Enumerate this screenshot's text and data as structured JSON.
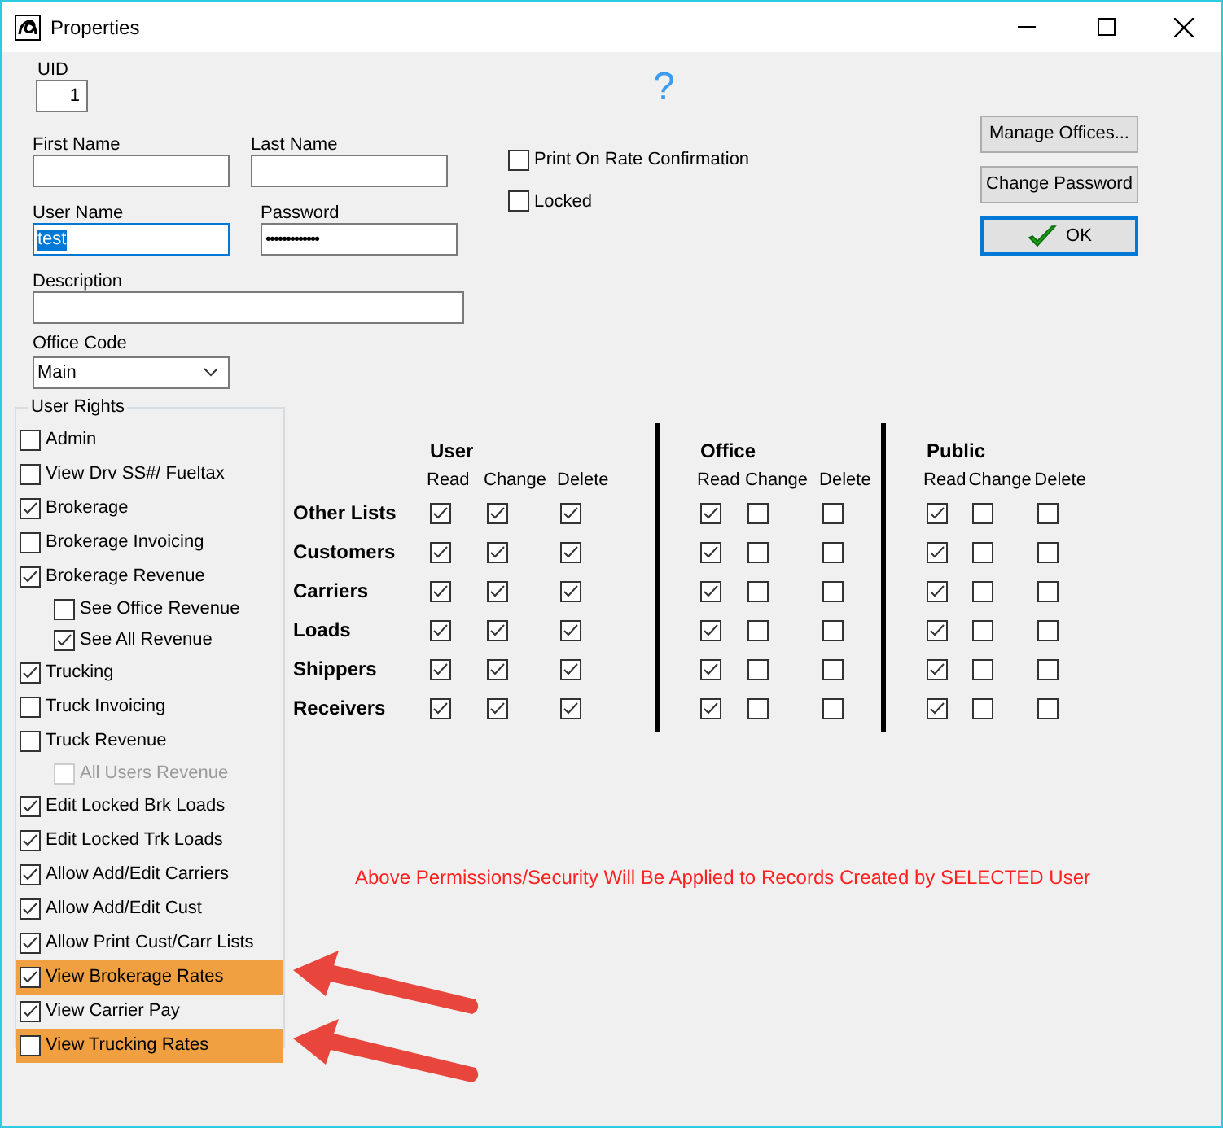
{
  "window": {
    "title": "Properties"
  },
  "uid": {
    "label": "UID",
    "value": "1"
  },
  "help": "?",
  "fields": [
    {
      "label": "First Name",
      "kind": "text"
    },
    {
      "label": "Last Name",
      "kind": "text"
    },
    {
      "label": "User Name",
      "kind": "text",
      "value": "test",
      "focused": true
    },
    {
      "label": "Password",
      "kind": "password",
      "value": "•••••••••••••",
      "focused": false
    },
    {
      "label": "Description",
      "kind": "text"
    },
    {
      "label": "Office Code",
      "kind": "select",
      "value": "Main"
    }
  ],
  "options": [
    {
      "label": "Print On Rate Confirmation",
      "checked": false
    },
    {
      "label": "Locked",
      "checked": false
    }
  ],
  "buttons": [
    {
      "label": "Manage Offices...",
      "default": false
    },
    {
      "label": "Change Password",
      "default": false
    },
    {
      "label": "OK",
      "default": true
    }
  ],
  "user_rights": {
    "title": "User Rights",
    "items": [
      {
        "label": "Admin",
        "checked": false,
        "highlighted": false
      },
      {
        "label": "View Drv SS#/ Fueltax",
        "checked": false,
        "highlighted": false
      },
      {
        "label": "Brokerage",
        "checked": true,
        "highlighted": false
      },
      {
        "label": "Brokerage Invoicing",
        "checked": false,
        "highlighted": false
      },
      {
        "label": "Brokerage Revenue",
        "checked": true,
        "highlighted": false,
        "children": [
          {
            "label": "See Office Revenue",
            "checked": false,
            "disabled": false
          },
          {
            "label": "See All Revenue",
            "checked": true,
            "disabled": false
          }
        ]
      },
      {
        "label": "Trucking",
        "checked": true,
        "highlighted": false
      },
      {
        "label": "Truck Invoicing",
        "checked": false,
        "highlighted": false
      },
      {
        "label": "Truck Revenue",
        "checked": false,
        "highlighted": false,
        "children": [
          {
            "label": "All Users Revenue",
            "checked": false,
            "disabled": true
          }
        ]
      },
      {
        "label": "Edit Locked Brk Loads",
        "checked": true,
        "highlighted": false
      },
      {
        "label": "Edit Locked Trk Loads",
        "checked": true,
        "highlighted": false
      },
      {
        "label": "Allow Add/Edit Carriers",
        "checked": true,
        "highlighted": false
      },
      {
        "label": "Allow Add/Edit Cust",
        "checked": true,
        "highlighted": false
      },
      {
        "label": "Allow Print Cust/Carr Lists",
        "checked": true,
        "highlighted": false
      },
      {
        "label": "View Brokerage Rates",
        "checked": true,
        "highlighted": true
      },
      {
        "label": "View Carrier Pay",
        "checked": true,
        "highlighted": false
      },
      {
        "label": "View Trucking Rates",
        "checked": false,
        "highlighted": true
      }
    ]
  },
  "permissions": {
    "groups": [
      {
        "name": "User",
        "columns": [
          "Read",
          "Change",
          "Delete"
        ]
      },
      {
        "name": "Office",
        "columns": [
          "Read",
          "Change",
          "Delete"
        ]
      },
      {
        "name": "Public",
        "columns": [
          "Read",
          "Change",
          "Delete"
        ]
      }
    ],
    "rows": [
      {
        "label": "Other Lists",
        "checked": [
          true,
          true,
          true,
          true,
          false,
          false,
          true,
          false,
          false
        ]
      },
      {
        "label": "Customers",
        "checked": [
          true,
          true,
          true,
          true,
          false,
          false,
          true,
          false,
          false
        ]
      },
      {
        "label": "Carriers",
        "checked": [
          true,
          true,
          true,
          true,
          false,
          false,
          true,
          false,
          false
        ]
      },
      {
        "label": "Loads",
        "checked": [
          true,
          true,
          true,
          true,
          false,
          false,
          true,
          false,
          false
        ]
      },
      {
        "label": "Shippers",
        "checked": [
          true,
          true,
          true,
          true,
          false,
          false,
          true,
          false,
          false
        ]
      },
      {
        "label": "Receivers",
        "checked": [
          true,
          true,
          true,
          true,
          false,
          false,
          true,
          false,
          false
        ]
      }
    ]
  },
  "note": "Above Permissions/Security Will Be Applied to Records Created by SELECTED User"
}
